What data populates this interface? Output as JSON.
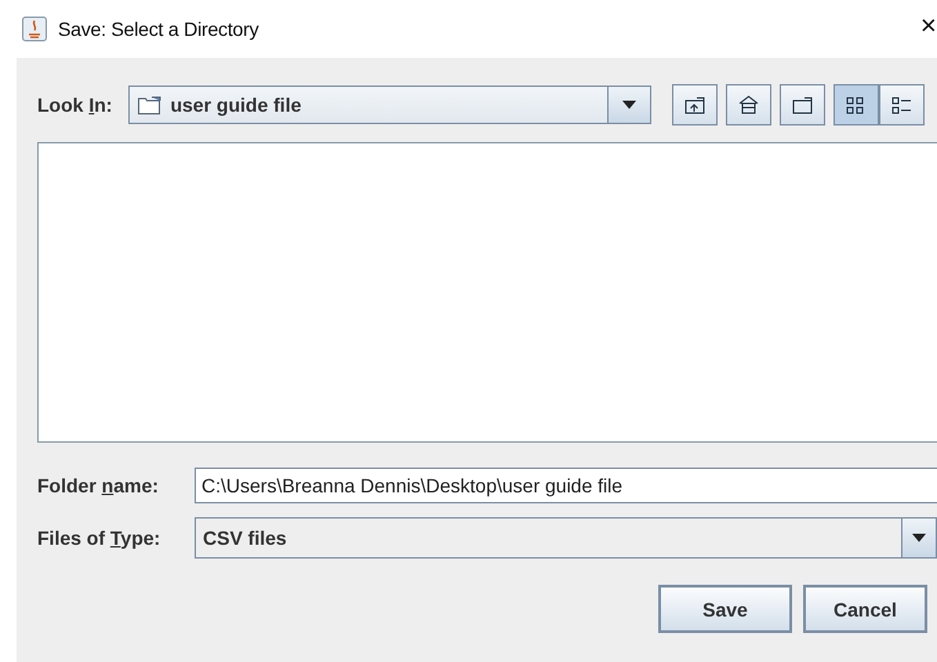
{
  "window": {
    "title": "Save: Select a Directory",
    "close": "×"
  },
  "look_in": {
    "label": [
      {
        "text": "Look ",
        "underlined": false
      },
      {
        "text": "I",
        "underlined": true
      },
      {
        "text": "n:",
        "underlined": false
      }
    ],
    "value": "user guide file"
  },
  "toolbar": [
    {
      "kind": "up",
      "selected": false
    },
    {
      "kind": "home",
      "selected": false
    },
    {
      "kind": "new-folder",
      "selected": false
    },
    {
      "kind": "list",
      "selected": true
    },
    {
      "kind": "details",
      "selected": false
    }
  ],
  "folder_name": {
    "label": [
      {
        "text": "Folder ",
        "underlined": false
      },
      {
        "text": "n",
        "underlined": true
      },
      {
        "text": "ame:",
        "underlined": false
      }
    ],
    "value": "C:\\Users\\Breanna Dennis\\Desktop\\user guide file"
  },
  "file_type": {
    "label": [
      {
        "text": "Files of ",
        "underlined": false
      },
      {
        "text": "T",
        "underlined": true
      },
      {
        "text": "ype:",
        "underlined": false
      }
    ],
    "value": "CSV files"
  },
  "buttons": [
    "Save",
    "Cancel"
  ]
}
